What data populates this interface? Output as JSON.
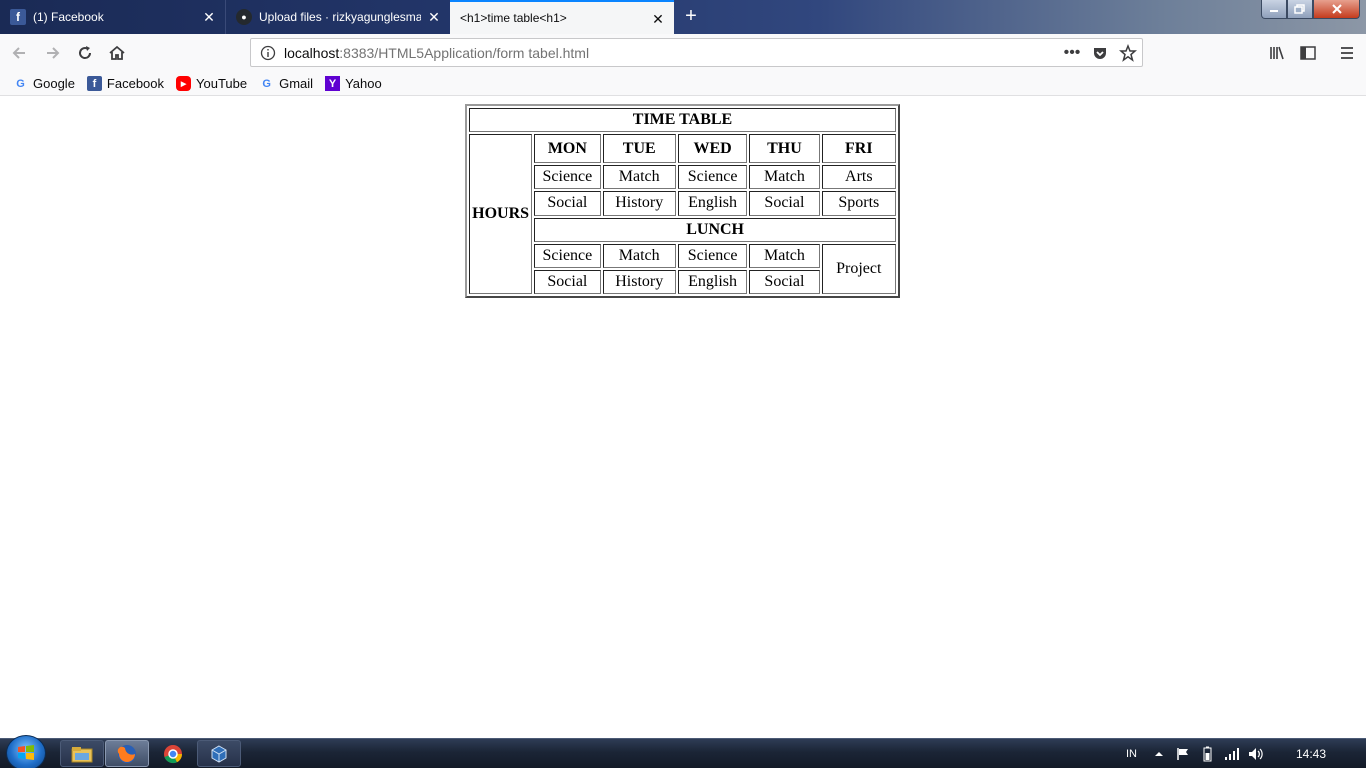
{
  "browser": {
    "tabs": [
      {
        "title": "(1) Facebook",
        "icon": "facebook-icon",
        "active": false
      },
      {
        "title": "Upload files · rizkyagunglesmana",
        "icon": "github-icon",
        "active": false
      },
      {
        "title": "<h1>time table<h1>",
        "icon": "",
        "active": true
      }
    ],
    "new_tab_label": "+",
    "url": {
      "host": "localhost",
      "rest": ":8383/HTML5Application/form tabel.html"
    },
    "bookmarks": [
      {
        "label": "Google",
        "icon": "google-icon"
      },
      {
        "label": "Facebook",
        "icon": "facebook-icon"
      },
      {
        "label": "YouTube",
        "icon": "youtube-icon"
      },
      {
        "label": "Gmail",
        "icon": "google-icon"
      },
      {
        "label": "Yahoo",
        "icon": "yahoo-icon"
      }
    ]
  },
  "timetable": {
    "title": "TIME TABLE",
    "row_header": "HOURS",
    "days": [
      "MON",
      "TUE",
      "WED",
      "THU",
      "FRI"
    ],
    "morning": [
      [
        "Science",
        "Match",
        "Science",
        "Match",
        "Arts"
      ],
      [
        "Social",
        "History",
        "English",
        "Social",
        "Sports"
      ]
    ],
    "lunch": "LUNCH",
    "afternoon": [
      [
        "Science",
        "Match",
        "Science",
        "Match"
      ],
      [
        "Social",
        "History",
        "English",
        "Social"
      ]
    ],
    "friday_afternoon": "Project"
  },
  "taskbar": {
    "language": "IN",
    "clock": "14:43",
    "apps": [
      "windows-explorer-icon",
      "firefox-icon",
      "chrome-icon",
      "virtualbox-icon"
    ]
  }
}
